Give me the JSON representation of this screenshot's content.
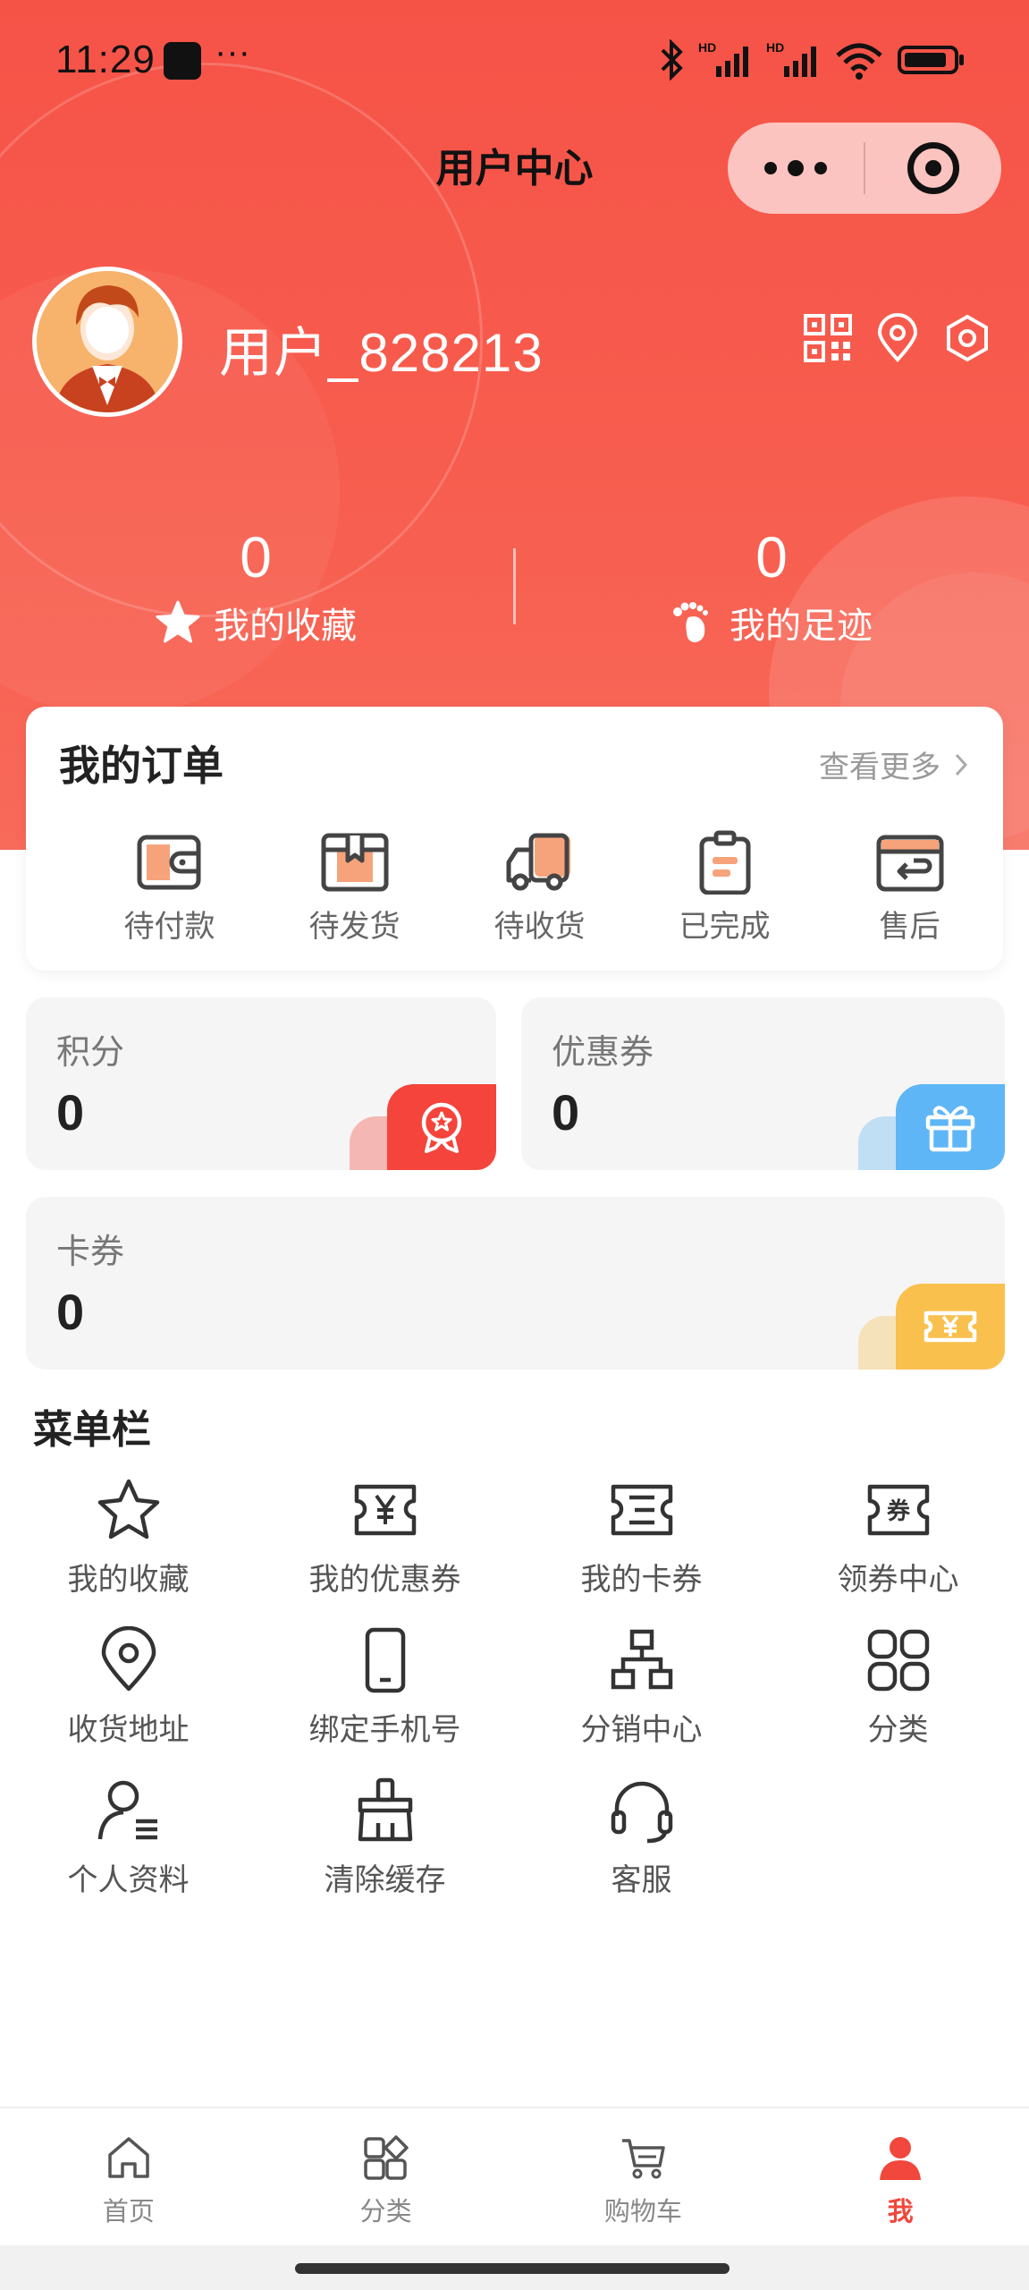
{
  "status_bar": {
    "time": "11:29",
    "dots": "···"
  },
  "nav": {
    "title": "用户中心"
  },
  "user": {
    "name": "用户_828213"
  },
  "stats": [
    {
      "value": "0",
      "label": "我的收藏",
      "icon": "star-icon"
    },
    {
      "value": "0",
      "label": "我的足迹",
      "icon": "footprint-icon"
    }
  ],
  "orders": {
    "title": "我的订单",
    "more": "查看更多",
    "items": [
      {
        "label": "待付款",
        "icon": "wallet-icon"
      },
      {
        "label": "待发货",
        "icon": "package-icon"
      },
      {
        "label": "待收货",
        "icon": "truck-icon"
      },
      {
        "label": "已完成",
        "icon": "clipboard-icon"
      },
      {
        "label": "售后",
        "icon": "return-icon"
      }
    ]
  },
  "assets": {
    "points": {
      "label": "积分",
      "value": "0",
      "icon": "medal-icon",
      "color": "#f5443b"
    },
    "coupons": {
      "label": "优惠券",
      "value": "0",
      "icon": "gift-icon",
      "color": "#5fb6f6"
    },
    "cards": {
      "label": "卡券",
      "value": "0",
      "icon": "yen-ticket-icon",
      "color": "#f9c04e"
    }
  },
  "menu": {
    "title": "菜单栏",
    "items": [
      {
        "label": "我的收藏",
        "icon": "star-icon"
      },
      {
        "label": "我的优惠券",
        "icon": "yen-coupon-icon"
      },
      {
        "label": "我的卡券",
        "icon": "card-ticket-icon"
      },
      {
        "label": "领券中心",
        "icon": "coupon-center-icon"
      },
      {
        "label": "收货地址",
        "icon": "location-icon"
      },
      {
        "label": "绑定手机号",
        "icon": "phone-icon"
      },
      {
        "label": "分销中心",
        "icon": "distribution-icon"
      },
      {
        "label": "分类",
        "icon": "grid-icon"
      },
      {
        "label": "个人资料",
        "icon": "profile-icon"
      },
      {
        "label": "清除缓存",
        "icon": "broom-icon"
      },
      {
        "label": "客服",
        "icon": "headset-icon"
      }
    ]
  },
  "tabs": [
    {
      "label": "首页",
      "icon": "home-icon"
    },
    {
      "label": "分类",
      "icon": "category-icon"
    },
    {
      "label": "购物车",
      "icon": "cart-icon"
    },
    {
      "label": "我",
      "icon": "user-icon",
      "active": true
    }
  ],
  "colors": {
    "brand": "#f65347",
    "active_tab": "#f1473c"
  }
}
